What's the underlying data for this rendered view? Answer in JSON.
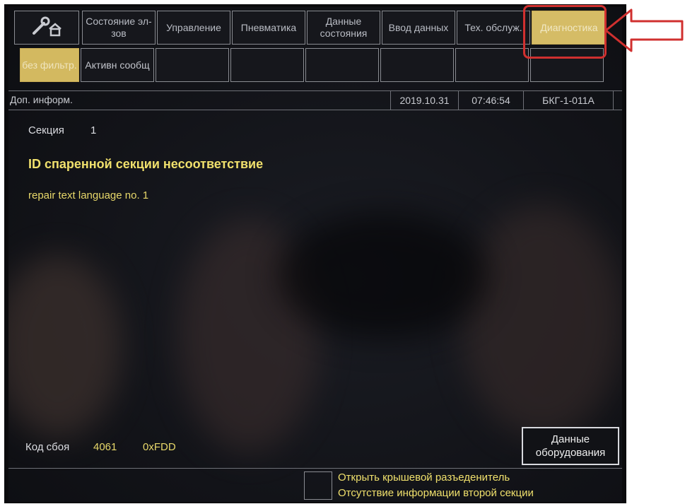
{
  "tabs": [
    {
      "label": "Состояние эл-зов",
      "active": false
    },
    {
      "label": "Управление",
      "active": false
    },
    {
      "label": "Пневматика",
      "active": false
    },
    {
      "label": "Данные состояния",
      "active": false
    },
    {
      "label": "Ввод данных",
      "active": false
    },
    {
      "label": "Тех. обслуж.",
      "active": false
    },
    {
      "label": "Диагностика",
      "active": true
    }
  ],
  "subtabs": [
    {
      "label": "без фильтр.",
      "active": true
    },
    {
      "label": "Активн сообщ",
      "active": false
    }
  ],
  "infobar": {
    "left": "Доп. информ.",
    "date": "2019.10.31",
    "time": "07:46:54",
    "device": "БКГ-1-011А"
  },
  "detail": {
    "section_label": "Секция",
    "section_value": "1",
    "message_title": "ID спаренной секции несоответствие",
    "repair_text": "repair text language no. 1",
    "fault_code_label": "Код сбоя",
    "fault_code_value": "4061",
    "fault_code_hex": "0xFDD"
  },
  "equipment_button": {
    "line1": "Данные",
    "line2": "оборудования"
  },
  "status_messages": [
    "Открыть крышевой разъеденитель",
    "Отсутствие информации второй секции"
  ],
  "colors": {
    "accent": "#d5bc66",
    "highlight": "#d0302f",
    "message_text": "#f0e06c"
  },
  "icons": {
    "home": "wrench-house-icon",
    "pointer": "red-arrow-icon"
  }
}
